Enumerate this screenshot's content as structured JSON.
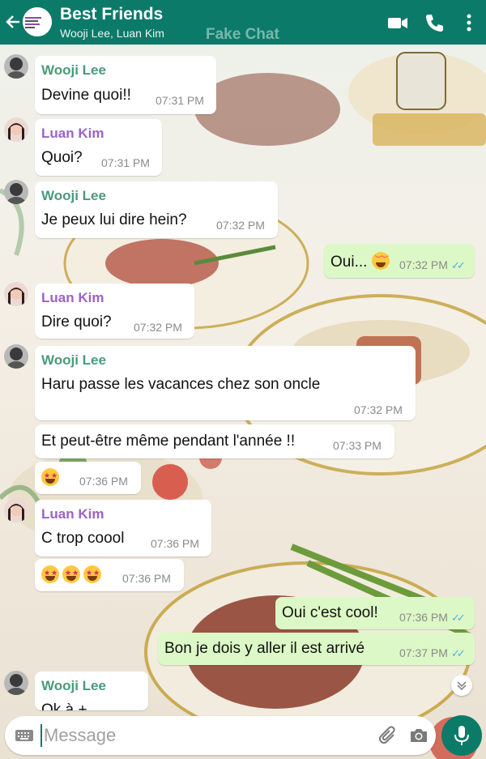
{
  "header": {
    "title": "Best Friends",
    "subtitle": "Wooji Lee, Luan Kim",
    "watermark": "Fake Chat",
    "icons": [
      "back-arrow-icon",
      "video-call-icon",
      "phone-icon",
      "more-vert-icon"
    ]
  },
  "colors": {
    "header_bg": "#0b7a69",
    "outgoing_bubble": "#dcf8c6",
    "incoming_bubble": "#ffffff",
    "wooji_name": "#4a9a78",
    "luan_name": "#9b63c4",
    "read_ticks": "#4fb0e0"
  },
  "messages": [
    {
      "sender": "Wooji Lee",
      "text": "Devine quoi!!",
      "time": "07:31 PM"
    },
    {
      "sender": "Luan Kim",
      "text": "Quoi?",
      "time": "07:31 PM"
    },
    {
      "sender": "Wooji Lee",
      "text": "Je peux lui dire hein?",
      "time": "07:32 PM"
    },
    {
      "sender": "me",
      "text": "Oui...",
      "emoji": "grinning-sweat",
      "time": "07:32 PM",
      "ticks": "✓✓"
    },
    {
      "sender": "Luan Kim",
      "text": "Dire quoi?",
      "time": "07:32 PM"
    },
    {
      "sender": "Wooji Lee",
      "text": "Haru passe les vacances chez son oncle",
      "time": "07:32 PM"
    },
    {
      "sender": "",
      "text": "Et peut-être même pendant l'année !!",
      "time": "07:33 PM"
    },
    {
      "sender": "",
      "text": "",
      "emoji": "star-struck",
      "time": "07:36 PM"
    },
    {
      "sender": "Luan Kim",
      "text": "C trop coool",
      "time": "07:36 PM"
    },
    {
      "sender": "",
      "text": "",
      "emoji": "star-struck x3",
      "time": "07:36 PM"
    },
    {
      "sender": "me",
      "text": "Oui c'est cool!",
      "time": "07:36 PM",
      "ticks": "✓✓"
    },
    {
      "sender": "me",
      "text": "Bon je dois y aller il est arrivé",
      "time": "07:37 PM",
      "ticks": "✓✓"
    },
    {
      "sender": "Wooji Lee",
      "text": "Ok à +",
      "time": ""
    }
  ],
  "composer": {
    "placeholder": "Message",
    "icons": [
      "keyboard-icon",
      "attach-icon",
      "camera-icon",
      "mic-icon"
    ]
  }
}
